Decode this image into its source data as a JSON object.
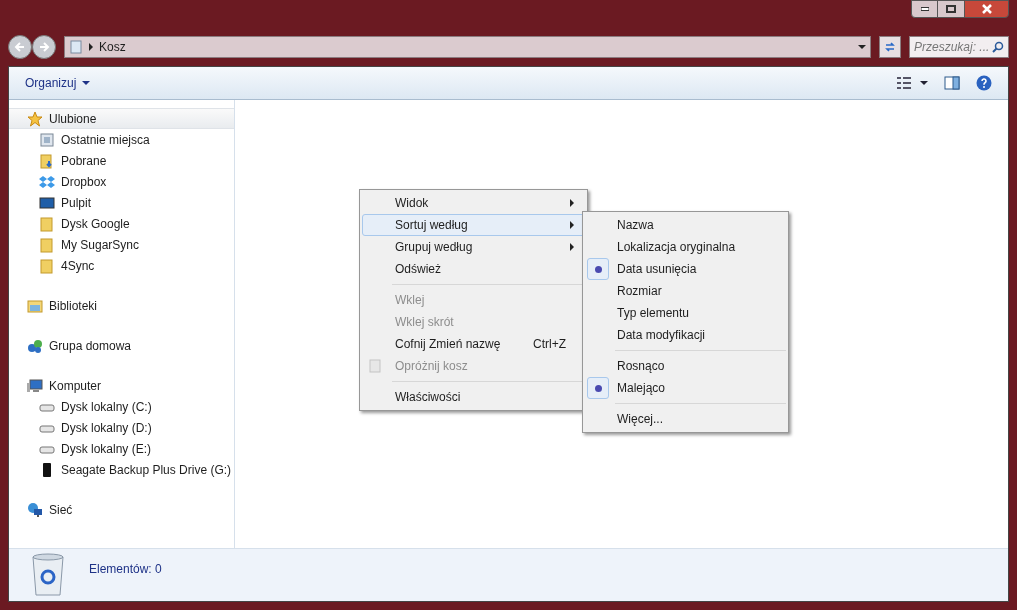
{
  "address_bar": {
    "path": "Kosz"
  },
  "search": {
    "placeholder": "Przeszukaj: ..."
  },
  "toolbar": {
    "organize": "Organizuj"
  },
  "sidebar": {
    "groups": [
      {
        "label": "Ulubione",
        "kind": "star",
        "selected": true,
        "children": [
          {
            "label": "Ostatnie miejsca",
            "kind": "recent"
          },
          {
            "label": "Pobrane",
            "kind": "download"
          },
          {
            "label": "Dropbox",
            "kind": "dropbox"
          },
          {
            "label": "Pulpit",
            "kind": "desktop"
          },
          {
            "label": "Dysk Google",
            "kind": "folder"
          },
          {
            "label": "My SugarSync",
            "kind": "folder"
          },
          {
            "label": "4Sync",
            "kind": "folder"
          }
        ]
      },
      {
        "label": "Biblioteki",
        "kind": "library",
        "selected": false
      },
      {
        "label": "Grupa domowa",
        "kind": "homegroup",
        "selected": false
      },
      {
        "label": "Komputer",
        "kind": "computer",
        "selected": false,
        "children": [
          {
            "label": "Dysk lokalny (C:)",
            "kind": "drive"
          },
          {
            "label": "Dysk lokalny (D:)",
            "kind": "drive"
          },
          {
            "label": "Dysk lokalny (E:)",
            "kind": "drive"
          },
          {
            "label": "Seagate Backup Plus Drive (G:)",
            "kind": "external"
          }
        ]
      },
      {
        "label": "Sieć",
        "kind": "network",
        "selected": false
      }
    ]
  },
  "context_menu": {
    "items": [
      {
        "kind": "item",
        "label": "Widok",
        "submenu": true,
        "disabled": false,
        "selected": false
      },
      {
        "kind": "item",
        "label": "Sortuj według",
        "submenu": true,
        "disabled": false,
        "selected": true
      },
      {
        "kind": "item",
        "label": "Grupuj według",
        "submenu": true,
        "disabled": false,
        "selected": false
      },
      {
        "kind": "item",
        "label": "Odśwież",
        "submenu": false,
        "disabled": false,
        "selected": false
      },
      {
        "kind": "separator"
      },
      {
        "kind": "item",
        "label": "Wklej",
        "submenu": false,
        "disabled": true,
        "selected": false
      },
      {
        "kind": "item",
        "label": "Wklej skrót",
        "submenu": false,
        "disabled": true,
        "selected": false
      },
      {
        "kind": "item",
        "label": "Cofnij Zmień nazwę",
        "shortcut": "Ctrl+Z",
        "submenu": false,
        "disabled": false,
        "selected": false
      },
      {
        "kind": "bin_item",
        "label": "Opróżnij kosz",
        "submenu": false,
        "disabled": true,
        "selected": false
      },
      {
        "kind": "separator"
      },
      {
        "kind": "item",
        "label": "Właściwości",
        "submenu": false,
        "disabled": false,
        "selected": false
      }
    ]
  },
  "sort_submenu": {
    "items": [
      {
        "kind": "item",
        "label": "Nazwa",
        "checked": false
      },
      {
        "kind": "item",
        "label": "Lokalizacja oryginalna",
        "checked": false
      },
      {
        "kind": "item",
        "label": "Data usunięcia",
        "checked": true
      },
      {
        "kind": "item",
        "label": "Rozmiar",
        "checked": false
      },
      {
        "kind": "item",
        "label": "Typ elementu",
        "checked": false
      },
      {
        "kind": "item",
        "label": "Data modyfikacji",
        "checked": false
      },
      {
        "kind": "separator"
      },
      {
        "kind": "item",
        "label": "Rosnąco",
        "checked": false
      },
      {
        "kind": "item",
        "label": "Malejąco",
        "checked": true
      },
      {
        "kind": "separator"
      },
      {
        "kind": "item",
        "label": "Więcej...",
        "checked": false
      }
    ]
  },
  "status_bar": {
    "text": "Elementów: 0"
  }
}
